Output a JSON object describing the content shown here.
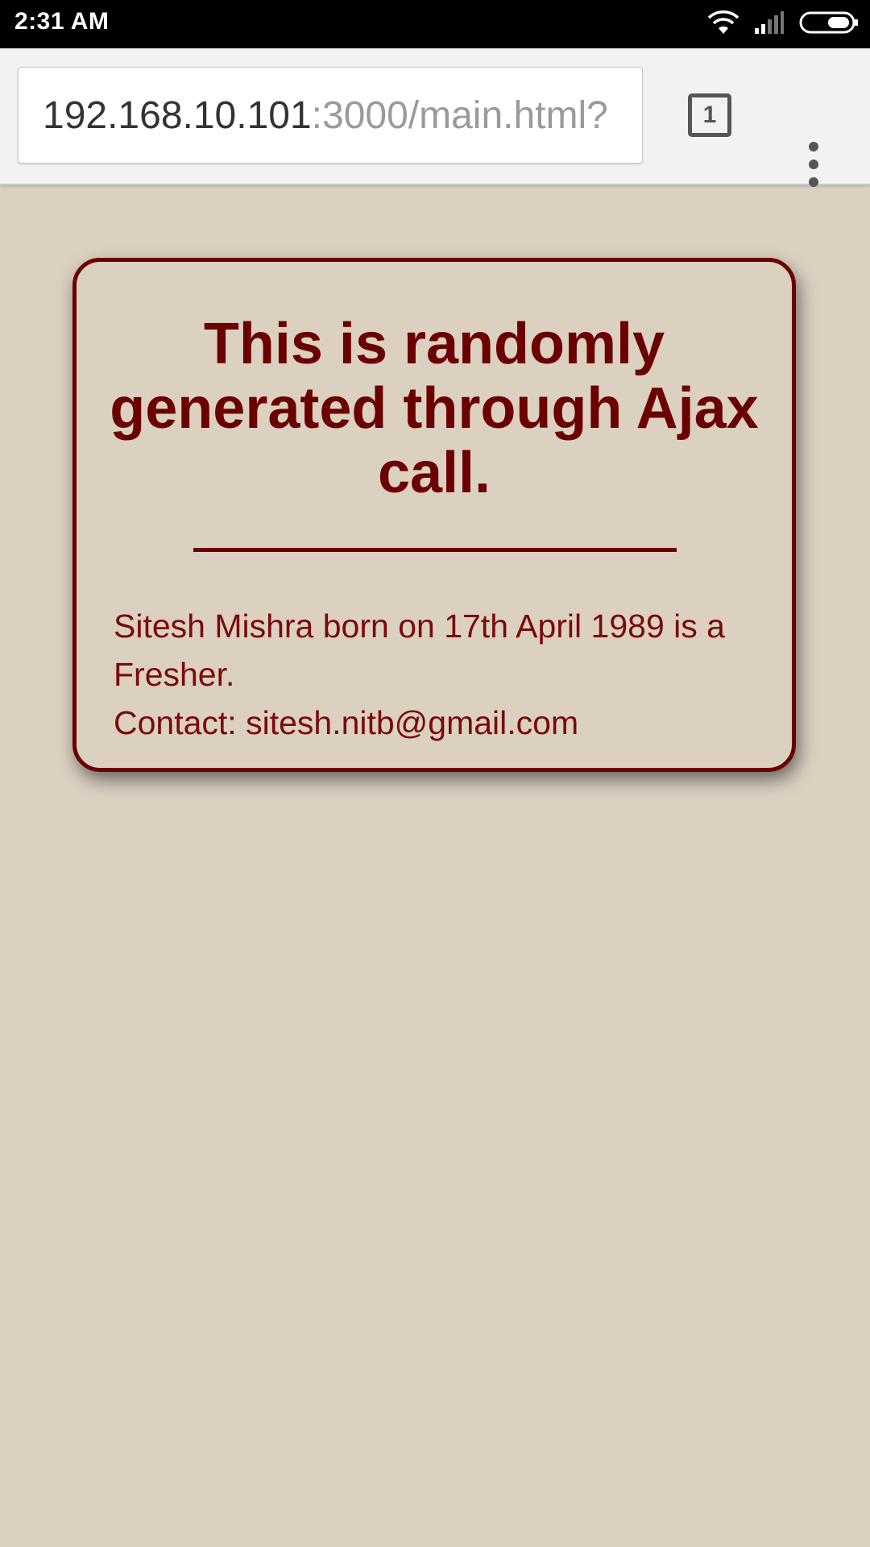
{
  "status_bar": {
    "time": "2:31 AM",
    "icons": [
      "wifi-icon",
      "cell-signal-icon",
      "battery-icon"
    ]
  },
  "browser": {
    "url_host": "192.168.10.101",
    "url_rest": ":3000/main.html?",
    "tab_count": "1",
    "menu_icon": "more-vert-icon"
  },
  "card": {
    "title": "This is randomly generated through Ajax call.",
    "description": "Sitesh Mishra born on 17th April 1989 is a Fresher.",
    "contact": "Contact: sitesh.nitb@gmail.com"
  },
  "colors": {
    "background": "#dcd0c1",
    "accent": "#6b0000",
    "status_bar": "#000000",
    "toolbar": "#f2f2f2"
  }
}
